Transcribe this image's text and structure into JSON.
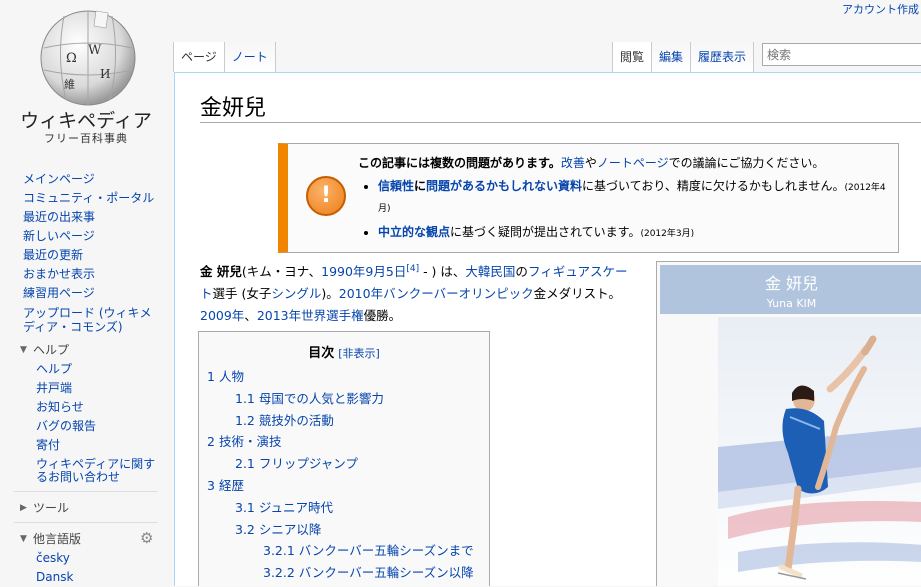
{
  "header": {
    "account": "アカウント作成",
    "tabs_left": [
      "ページ",
      "ノート"
    ],
    "tabs_right": [
      "閲覧",
      "編集",
      "履歴表示"
    ],
    "search_placeholder": "検索"
  },
  "logo": {
    "title": "ウィキペディア",
    "subtitle": "フリー百科事典",
    "glyphs": [
      "Ω",
      "W",
      "維",
      "И"
    ]
  },
  "sidebar": {
    "main": [
      "メインページ",
      "コミュニティ・ポータル",
      "最近の出来事",
      "新しいページ",
      "最近の更新",
      "おまかせ表示",
      "練習用ページ",
      "アップロード (ウィキメディア・コモンズ)"
    ],
    "help_heading": "ヘルプ",
    "help": [
      "ヘルプ",
      "井戸端",
      "お知らせ",
      "バグの報告",
      "寄付",
      "ウィキペディアに関するお問い合わせ"
    ],
    "tools_heading": "ツール",
    "lang_heading": "他言語版",
    "languages": [
      "česky",
      "Dansk"
    ]
  },
  "article": {
    "title": "金妍兒",
    "ambox": {
      "head": "この記事には複数の問題があります。",
      "head_link1": "改善",
      "head_mid": "や",
      "head_link2": "ノートページ",
      "head_end": "での議論にご協力ください。",
      "issue1_link1": "信頼性",
      "issue1_mid": "に",
      "issue1_link2": "問題があるかもしれない資料",
      "issue1_text": "に基づいており、精度に欠けるかもしれません。",
      "issue1_date": "(2012年4月)",
      "issue2_link": "中立的な観点",
      "issue2_text": "に基づく疑問が提出されています。",
      "issue2_date": "(2012年3月)"
    },
    "lead": {
      "name": "金 妍兒",
      "paren_open": "(キム・ヨナ、",
      "birth_link": "1990年9月5日",
      "ref": "[4]",
      "paren_close": " - ) は、",
      "country_link": "大韓民国",
      "t1": "の",
      "sport_link": "フィギュアスケート",
      "t2": "選手 (女子",
      "singles_link": "シングル",
      "t3": ")。",
      "olympics_link": "2010年バンクーバーオリンピック",
      "t4": "金メダリスト。",
      "y1_link": "2009年",
      "t5": "、",
      "y2_link": "2013年世界選手権",
      "t6": "優勝。"
    },
    "toc": {
      "title": "目次",
      "hide": "[非表示]",
      "items": [
        {
          "num": "1",
          "label": "人物"
        },
        {
          "num": "1.1",
          "label": "母国での人気と影響力"
        },
        {
          "num": "1.2",
          "label": "競技外の活動"
        },
        {
          "num": "2",
          "label": "技術・演技"
        },
        {
          "num": "2.1",
          "label": "フリップジャンプ"
        },
        {
          "num": "3",
          "label": "経歴"
        },
        {
          "num": "3.1",
          "label": "ジュニア時代"
        },
        {
          "num": "3.2",
          "label": "シニア以降"
        },
        {
          "num": "3.2.1",
          "label": "バンクーバー五輪シーズンまで"
        },
        {
          "num": "3.2.2",
          "label": "バンクーバー五輪シーズン以降"
        }
      ]
    },
    "infobox": {
      "name": "金 妍兒",
      "name_en": "Yuna KIM"
    }
  },
  "colors": {
    "link": "#0645ad",
    "ambox_border": "#f28500",
    "infobox_header": "#b0c4de",
    "content_border": "#a7d7f9"
  }
}
